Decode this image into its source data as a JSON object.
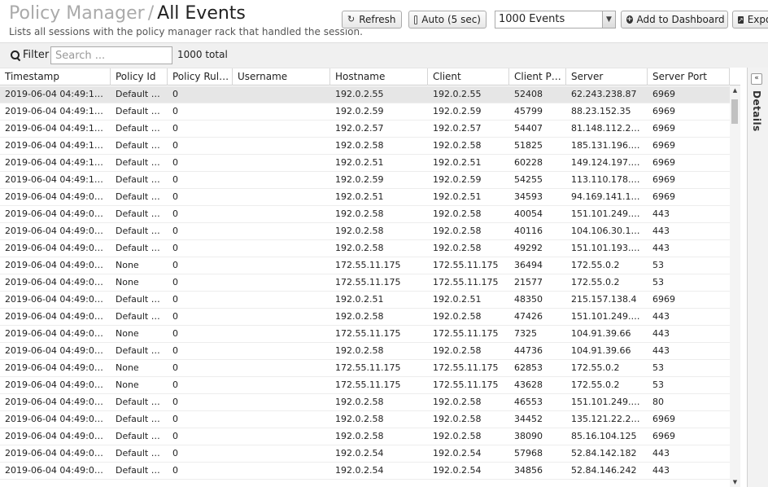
{
  "header": {
    "breadcrumb_root": "Policy Manager",
    "separator": "/",
    "title": "All Events",
    "subtitle": "Lists all sessions with the policy manager rack that handled the session.",
    "refresh_label": "Refresh",
    "auto_label": "Auto (5 sec)",
    "limit_selected": "1000 Events",
    "add_dashboard_label": "Add to Dashboard",
    "export_label": "Export"
  },
  "filter": {
    "label": "Filter",
    "placeholder": "Search ...",
    "total": "1000 total"
  },
  "details_label": "Details",
  "columns": [
    "Timestamp",
    "Policy Id",
    "Policy Rul…",
    "Username",
    "Hostname",
    "Client",
    "Client P…",
    "Server",
    "Server Port"
  ],
  "rows": [
    [
      "2019-06-04 04:49:1…",
      "Default …",
      "0",
      "",
      "192.0.2.55",
      "192.0.2.55",
      "52408",
      "62.243.238.87",
      "6969"
    ],
    [
      "2019-06-04 04:49:1…",
      "Default …",
      "0",
      "",
      "192.0.2.59",
      "192.0.2.59",
      "45799",
      "88.23.152.35",
      "6969"
    ],
    [
      "2019-06-04 04:49:1…",
      "Default …",
      "0",
      "",
      "192.0.2.57",
      "192.0.2.57",
      "54407",
      "81.148.112.2…",
      "6969"
    ],
    [
      "2019-06-04 04:49:1…",
      "Default …",
      "0",
      "",
      "192.0.2.58",
      "192.0.2.58",
      "51825",
      "185.131.196.…",
      "6969"
    ],
    [
      "2019-06-04 04:49:1…",
      "Default …",
      "0",
      "",
      "192.0.2.51",
      "192.0.2.51",
      "60228",
      "149.124.197.…",
      "6969"
    ],
    [
      "2019-06-04 04:49:1…",
      "Default …",
      "0",
      "",
      "192.0.2.59",
      "192.0.2.59",
      "54255",
      "113.110.178.…",
      "6969"
    ],
    [
      "2019-06-04 04:49:0…",
      "Default …",
      "0",
      "",
      "192.0.2.51",
      "192.0.2.51",
      "34593",
      "94.169.141.1…",
      "6969"
    ],
    [
      "2019-06-04 04:49:0…",
      "Default …",
      "0",
      "",
      "192.0.2.58",
      "192.0.2.58",
      "40054",
      "151.101.249.…",
      "443"
    ],
    [
      "2019-06-04 04:49:0…",
      "Default …",
      "0",
      "",
      "192.0.2.58",
      "192.0.2.58",
      "40116",
      "104.106.30.1…",
      "443"
    ],
    [
      "2019-06-04 04:49:0…",
      "Default …",
      "0",
      "",
      "192.0.2.58",
      "192.0.2.58",
      "49292",
      "151.101.193.…",
      "443"
    ],
    [
      "2019-06-04 04:49:0…",
      "None",
      "0",
      "",
      "172.55.11.175",
      "172.55.11.175",
      "36494",
      "172.55.0.2",
      "53"
    ],
    [
      "2019-06-04 04:49:0…",
      "None",
      "0",
      "",
      "172.55.11.175",
      "172.55.11.175",
      "21577",
      "172.55.0.2",
      "53"
    ],
    [
      "2019-06-04 04:49:0…",
      "Default …",
      "0",
      "",
      "192.0.2.51",
      "192.0.2.51",
      "48350",
      "215.157.138.4",
      "6969"
    ],
    [
      "2019-06-04 04:49:0…",
      "Default …",
      "0",
      "",
      "192.0.2.58",
      "192.0.2.58",
      "47426",
      "151.101.249.…",
      "443"
    ],
    [
      "2019-06-04 04:49:0…",
      "None",
      "0",
      "",
      "172.55.11.175",
      "172.55.11.175",
      "7325",
      "104.91.39.66",
      "443"
    ],
    [
      "2019-06-04 04:49:0…",
      "Default …",
      "0",
      "",
      "192.0.2.58",
      "192.0.2.58",
      "44736",
      "104.91.39.66",
      "443"
    ],
    [
      "2019-06-04 04:49:0…",
      "None",
      "0",
      "",
      "172.55.11.175",
      "172.55.11.175",
      "62853",
      "172.55.0.2",
      "53"
    ],
    [
      "2019-06-04 04:49:0…",
      "None",
      "0",
      "",
      "172.55.11.175",
      "172.55.11.175",
      "43628",
      "172.55.0.2",
      "53"
    ],
    [
      "2019-06-04 04:49:0…",
      "Default …",
      "0",
      "",
      "192.0.2.58",
      "192.0.2.58",
      "46553",
      "151.101.249.…",
      "80"
    ],
    [
      "2019-06-04 04:49:0…",
      "Default …",
      "0",
      "",
      "192.0.2.58",
      "192.0.2.58",
      "34452",
      "135.121.22.2…",
      "6969"
    ],
    [
      "2019-06-04 04:49:0…",
      "Default …",
      "0",
      "",
      "192.0.2.58",
      "192.0.2.58",
      "38090",
      "85.16.104.125",
      "6969"
    ],
    [
      "2019-06-04 04:49:0…",
      "Default …",
      "0",
      "",
      "192.0.2.54",
      "192.0.2.54",
      "57968",
      "52.84.142.182",
      "443"
    ],
    [
      "2019-06-04 04:49:0…",
      "Default …",
      "0",
      "",
      "192.0.2.54",
      "192.0.2.54",
      "34856",
      "52.84.146.242",
      "443"
    ]
  ]
}
